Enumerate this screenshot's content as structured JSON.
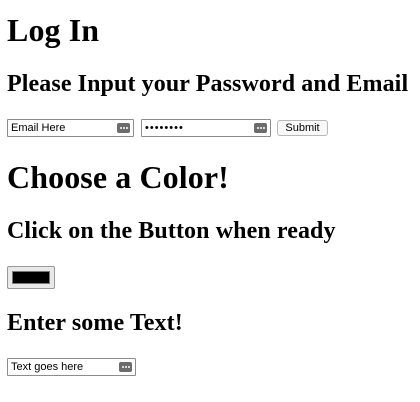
{
  "login": {
    "title": "Log In",
    "subtitle": "Please Input your Password and Email",
    "email": {
      "placeholder": "Email Here",
      "value": ""
    },
    "password": {
      "value": "••••••••"
    },
    "submit_label": "Submit"
  },
  "color_section": {
    "title": "Choose a Color!",
    "subtitle": "Click on the Button when ready",
    "selected_color": "#000000"
  },
  "text_section": {
    "title": "Enter some Text!",
    "input": {
      "placeholder": "Text goes here",
      "value": ""
    }
  },
  "icons": {
    "field_menu": "more-horizontal-icon"
  }
}
